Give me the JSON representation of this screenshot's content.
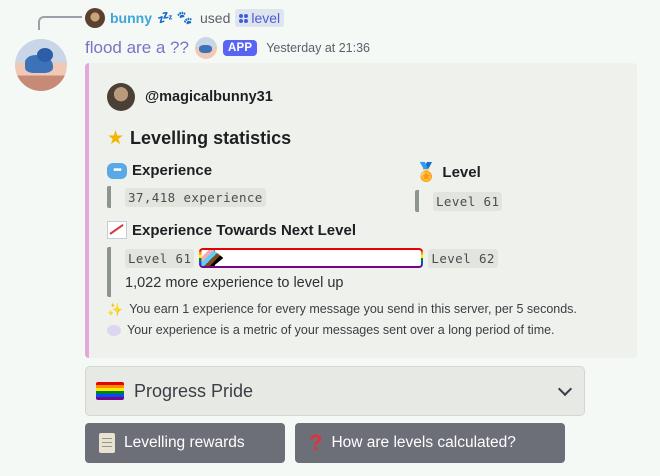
{
  "reply": {
    "username": "bunny",
    "emojis": "💤 🐾",
    "verb": "used",
    "command": "level"
  },
  "message": {
    "author": "flood are a ??",
    "badge": "APP",
    "timestamp": "Yesterday at 21:36"
  },
  "embed": {
    "accent_color": "#e4a6dc",
    "author_name": "@magicalbunny31",
    "title": "Levelling statistics",
    "experience": {
      "label": "Experience",
      "value": "37,418 experience"
    },
    "level": {
      "label": "Level",
      "value": "Level 61"
    },
    "next_level": {
      "label": "Experience Towards Next Level",
      "current": "Level 61",
      "next": "Level 62",
      "progress_fraction": 0.06,
      "remaining": "1,022 more experience to level up"
    },
    "footnotes": [
      "You earn 1 experience for every message you send in this server, per 5 seconds.",
      "Your experience is a metric of your messages sent over a long period of time."
    ]
  },
  "select": {
    "value": "Progress Pride"
  },
  "buttons": {
    "rewards": "Levelling rewards",
    "how": "How are levels calculated?"
  }
}
